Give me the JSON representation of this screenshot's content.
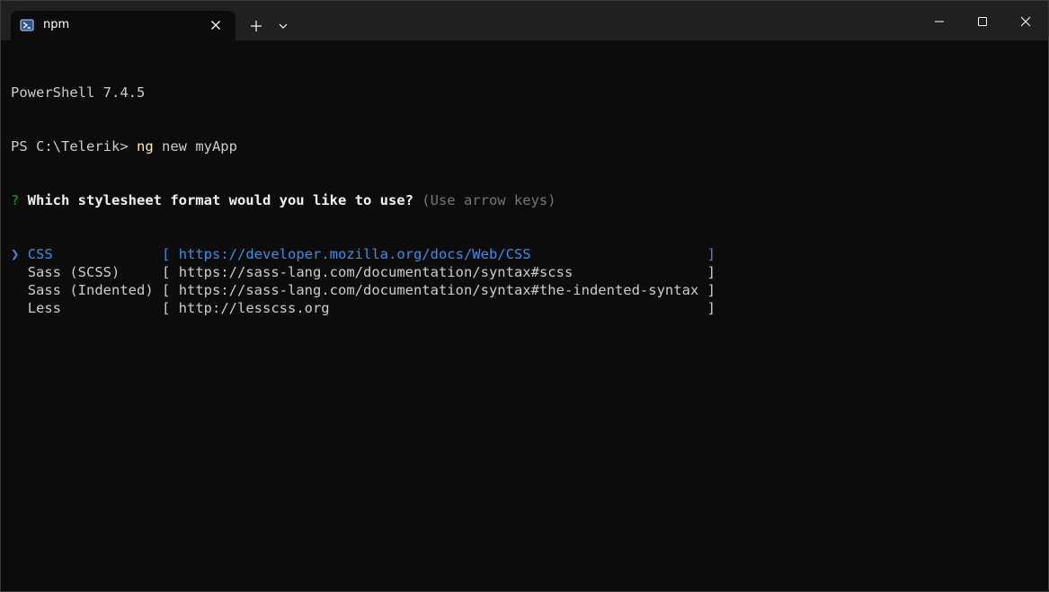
{
  "window": {
    "tab_title": "npm",
    "colors": {
      "titlebar": "#202020",
      "terminal_bg": "#0c0c0c",
      "text": "#cccccc",
      "accent_blue": "#3b8eea",
      "prompt_green": "#13a10e",
      "command_yellow": "#f9f1a5",
      "hint_gray": "#767676"
    },
    "icons": {
      "tab": "powershell-icon",
      "tab_close": "close-icon",
      "new_tab": "plus-icon",
      "dropdown": "chevron-down-icon",
      "minimize": "minimize-icon",
      "maximize": "maximize-icon",
      "close": "close-icon"
    }
  },
  "terminal": {
    "banner": "PowerShell 7.4.5",
    "prompt": "PS C:\\Telerik> ",
    "command_name": "ng",
    "command_args": " new myApp",
    "question_mark": "?",
    "question": " Which stylesheet format would you like to use?",
    "hint": " (Use arrow keys)",
    "pointer": "❯",
    "options": [
      {
        "name": "CSS",
        "url": "https://developer.mozilla.org/docs/Web/CSS",
        "selected": true
      },
      {
        "name": "Sass (SCSS)",
        "url": "https://sass-lang.com/documentation/syntax#scss",
        "selected": false
      },
      {
        "name": "Sass (Indented)",
        "url": "https://sass-lang.com/documentation/syntax#the-indented-syntax",
        "selected": false
      },
      {
        "name": "Less",
        "url": "http://lesscss.org",
        "selected": false
      }
    ]
  }
}
